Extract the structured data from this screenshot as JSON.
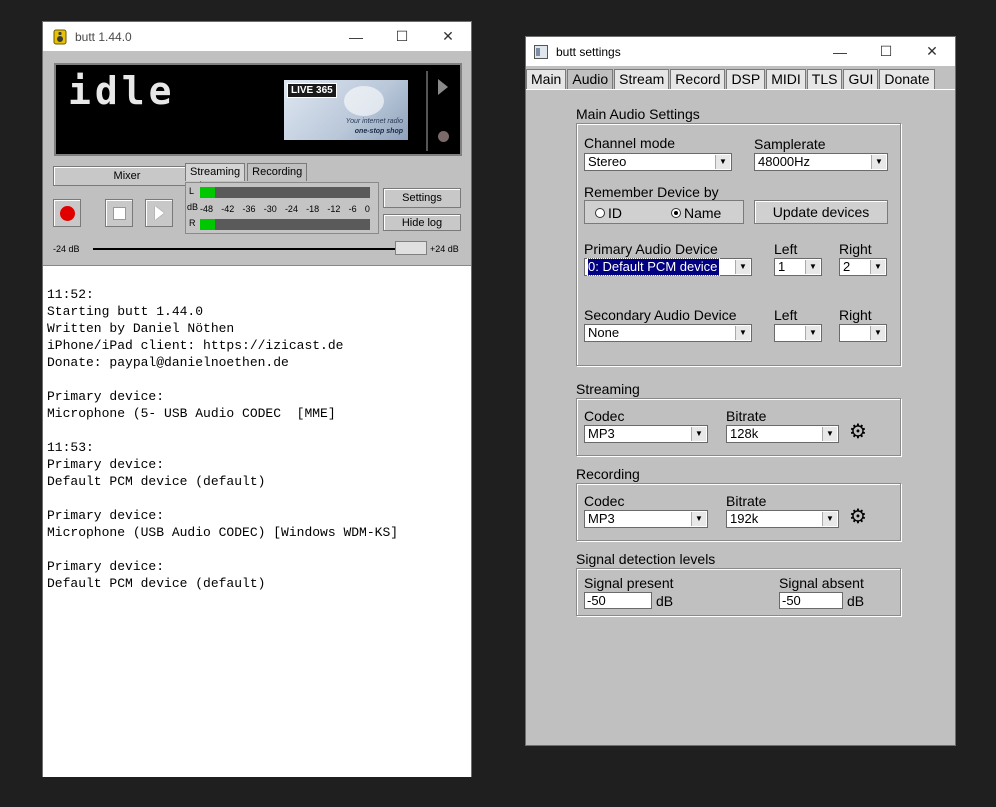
{
  "main_window": {
    "title": "butt 1.44.0",
    "lcd_status": "idle",
    "ad": {
      "logo": "LIVE 365",
      "line1": "Your internet radio",
      "line2": "one-stop shop"
    },
    "mixer_label": "Mixer",
    "tabs": [
      "Streaming",
      "Recording"
    ],
    "meter": {
      "left_label": "L",
      "db_label": "dB",
      "right_label": "R",
      "scale": [
        "-48",
        "-42",
        "-36",
        "-30",
        "-24",
        "-18",
        "-12",
        "-6",
        "0"
      ],
      "left_level": 0.09,
      "right_level": 0.09
    },
    "settings_label": "Settings",
    "hide_log_label": "Hide log",
    "gain_min": "-24 dB",
    "gain_max": "+24 dB",
    "log_lines": [
      "11:52:",
      "Starting butt 1.44.0",
      "Written by Daniel Nöthen",
      "iPhone/iPad client: https://izicast.de",
      "Donate: paypal@danielnoethen.de",
      "",
      "Primary device:",
      "Microphone (5- USB Audio CODEC  [MME]",
      "",
      "11:53:",
      "Primary device:",
      "Default PCM device (default)",
      "",
      "Primary device:",
      "Microphone (USB Audio CODEC) [Windows WDM-KS]",
      "",
      "Primary device:",
      "Default PCM device (default)"
    ]
  },
  "settings_window": {
    "title": "butt settings",
    "tabs": [
      "Main",
      "Audio",
      "Stream",
      "Record",
      "DSP",
      "MIDI",
      "TLS",
      "GUI",
      "Donate"
    ],
    "active_tab": "Audio",
    "main_audio": {
      "section_label": "Main Audio Settings",
      "channel_mode_label": "Channel mode",
      "channel_mode_value": "Stereo",
      "samplerate_label": "Samplerate",
      "samplerate_value": "48000Hz",
      "remember_label": "Remember Device by",
      "radio_id": "ID",
      "radio_name": "Name",
      "update_devices_label": "Update devices",
      "primary_label": "Primary Audio Device",
      "primary_value": "0: Default PCM device",
      "left_label": "Left",
      "left_value": "1",
      "right_label": "Right",
      "right_value": "2",
      "secondary_label": "Secondary Audio Device",
      "secondary_value": "None",
      "sec_left_label": "Left",
      "sec_right_label": "Right"
    },
    "streaming": {
      "section_label": "Streaming",
      "codec_label": "Codec",
      "codec_value": "MP3",
      "bitrate_label": "Bitrate",
      "bitrate_value": "128k"
    },
    "recording": {
      "section_label": "Recording",
      "codec_label": "Codec",
      "codec_value": "MP3",
      "bitrate_label": "Bitrate",
      "bitrate_value": "192k"
    },
    "signal": {
      "section_label": "Signal detection levels",
      "present_label": "Signal present",
      "present_value": "-50",
      "present_unit": "dB",
      "absent_label": "Signal absent",
      "absent_value": "-50",
      "absent_unit": "dB"
    }
  }
}
